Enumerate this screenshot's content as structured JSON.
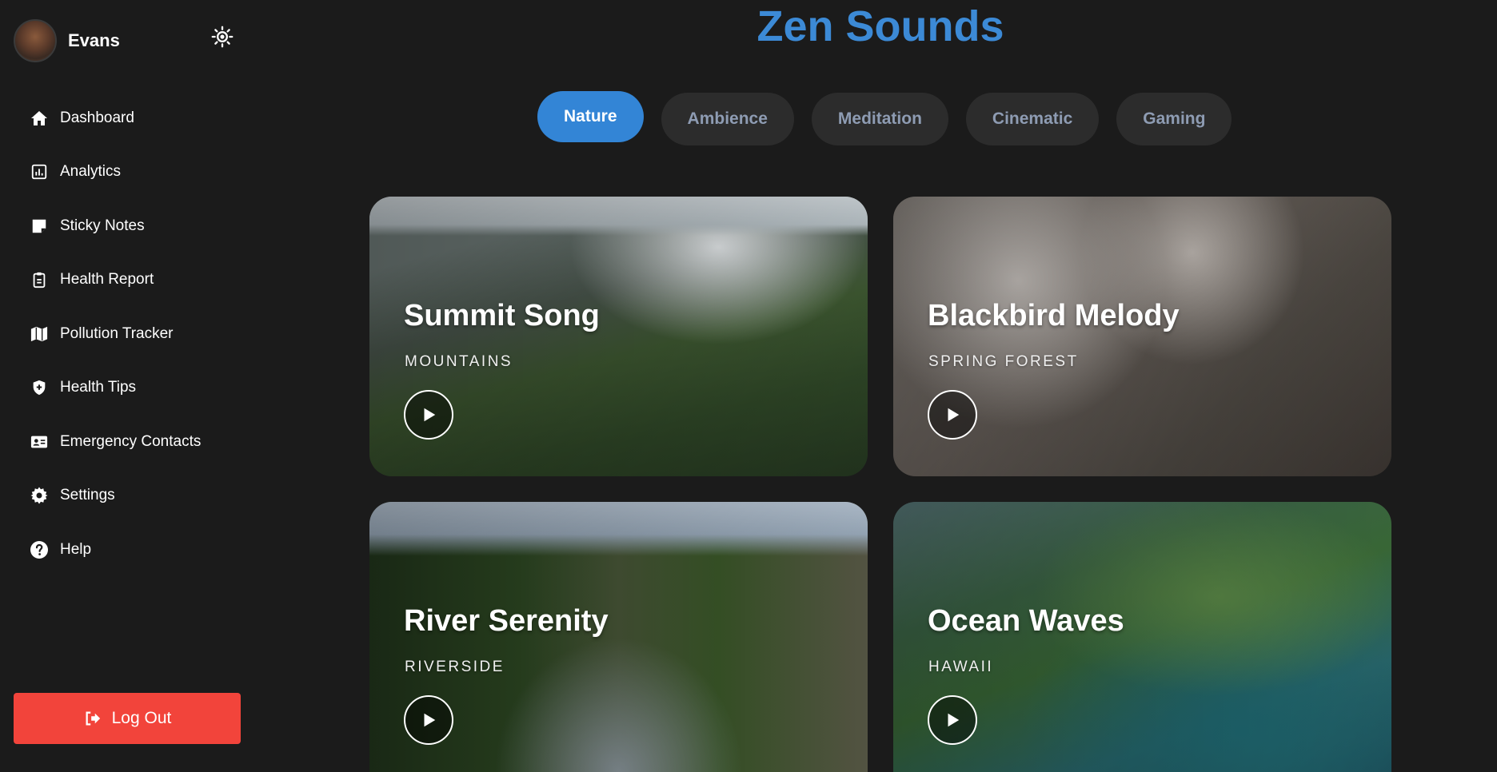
{
  "profile": {
    "name": "Evans"
  },
  "nav": {
    "items": [
      {
        "label": "Dashboard",
        "icon": "home-icon"
      },
      {
        "label": "Analytics",
        "icon": "analytics-icon"
      },
      {
        "label": "Sticky Notes",
        "icon": "sticky-note-icon"
      },
      {
        "label": "Health Report",
        "icon": "clipboard-icon"
      },
      {
        "label": "Pollution Tracker",
        "icon": "map-icon"
      },
      {
        "label": "Health Tips",
        "icon": "shield-plus-icon"
      },
      {
        "label": "Emergency Contacts",
        "icon": "contact-card-icon"
      },
      {
        "label": "Settings",
        "icon": "gear-icon"
      },
      {
        "label": "Help",
        "icon": "help-icon"
      }
    ]
  },
  "logout": {
    "label": "Log Out"
  },
  "main": {
    "title": "Zen Sounds",
    "tabs": [
      {
        "label": "Nature",
        "active": true
      },
      {
        "label": "Ambience",
        "active": false
      },
      {
        "label": "Meditation",
        "active": false
      },
      {
        "label": "Cinematic",
        "active": false
      },
      {
        "label": "Gaming",
        "active": false
      }
    ],
    "cards": [
      {
        "title": "Summit Song",
        "subtitle": "MOUNTAINS"
      },
      {
        "title": "Blackbird Melody",
        "subtitle": "SPRING FOREST"
      },
      {
        "title": "River Serenity",
        "subtitle": "RIVERSIDE"
      },
      {
        "title": "Ocean Waves",
        "subtitle": "HAWAII"
      }
    ]
  },
  "colors": {
    "background": "#1b1b1b",
    "accent": "#3385d6",
    "title": "#3c8ad6",
    "logout": "#f2443b",
    "tab_inactive_bg": "#2c2c2c",
    "tab_inactive_text": "#8e9cb3"
  }
}
